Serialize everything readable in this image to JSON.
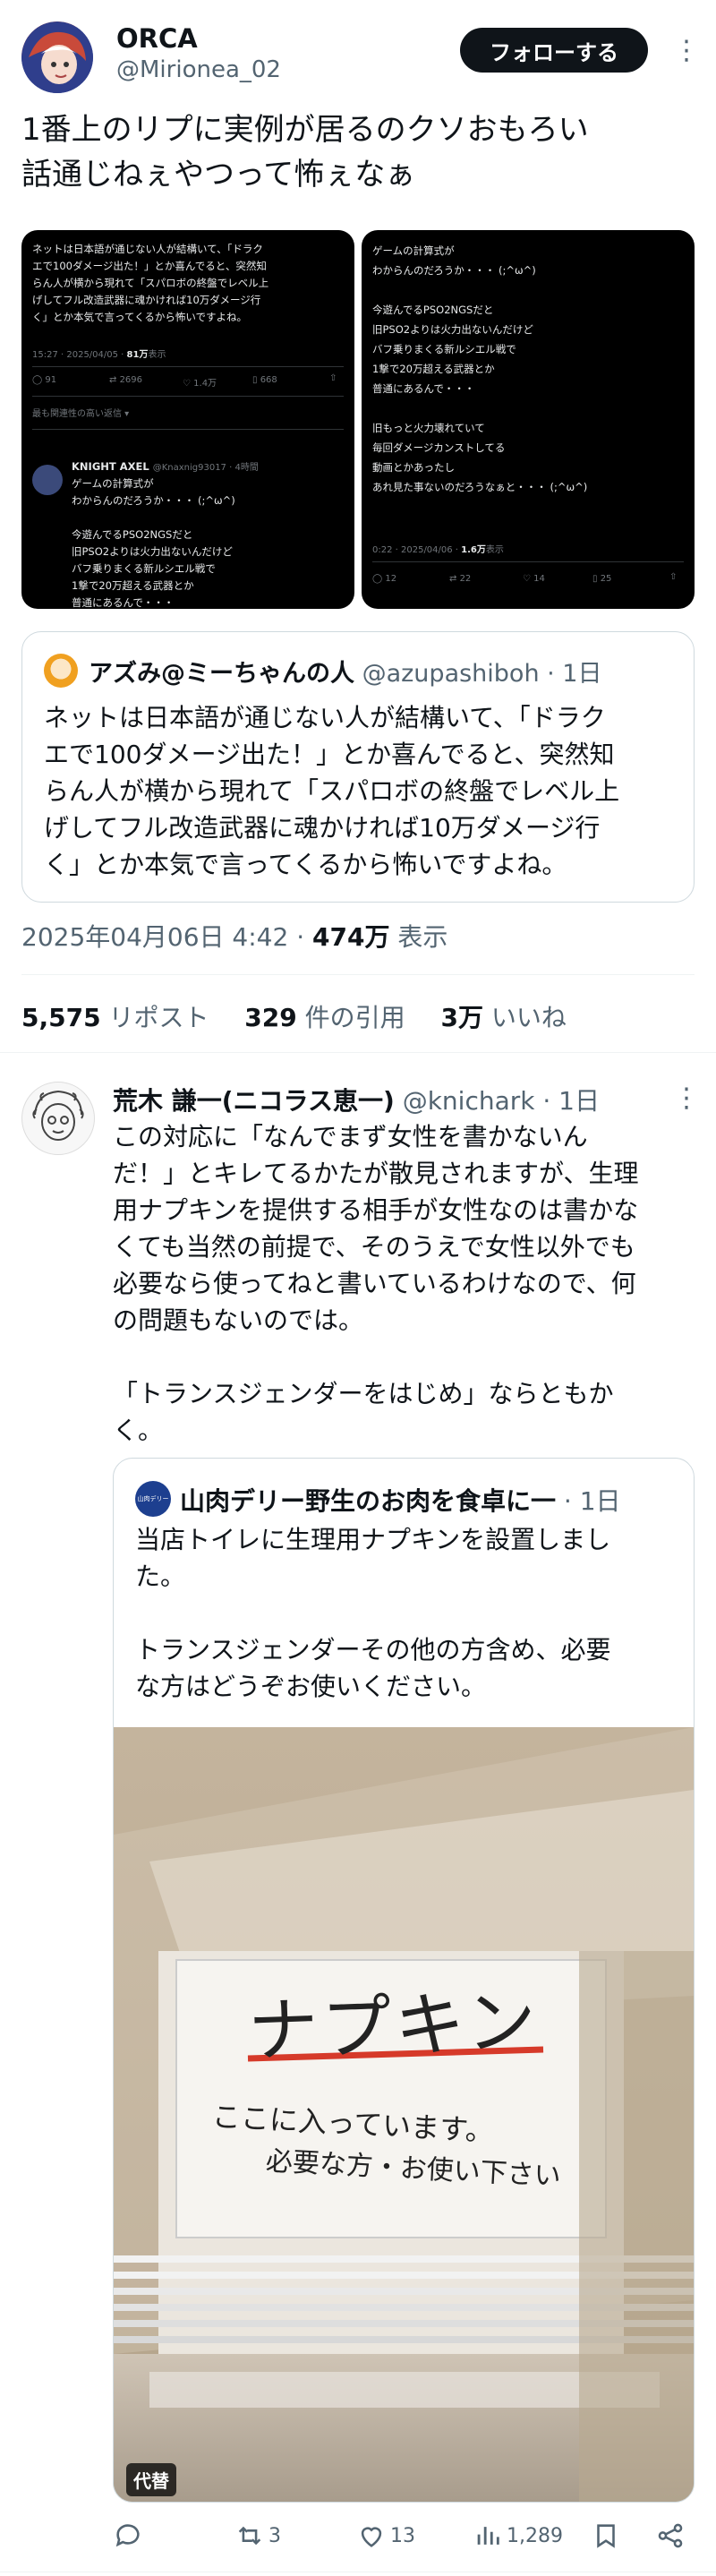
{
  "tweet": {
    "display_name": "ORCA",
    "handle": "@Mirionea_02",
    "follow_label": "フォローする",
    "more_icon": "⋮",
    "text_line1": "1番上のリプに実例が居るのクソおもろい",
    "text_line2": "話通じねぇやつって怖ぇなぁ",
    "timestamp": "2025年04月06日 4:42 · ",
    "views_count": "474万",
    "views_label": " 表示",
    "reposts_count": "5,575",
    "reposts_label": " リポスト",
    "quotes_count": "329",
    "quotes_label": " 件の引用",
    "likes_count": "3万",
    "likes_label": " いいね"
  },
  "image1": {
    "text_lines": [
      "ネットは日本語が通じない人が結構いて、「ドラク",
      "エで100ダメージ出た！」とか喜んでると、突然知",
      "らん人が横から現れて「スパロボの終盤でレベル上",
      "げしてフル改造武器に魂かければ10万ダメージ行",
      "く」とか本気で言ってくるから怖いですよね。"
    ],
    "meta_time": "15:27 · 2025/04/05 · ",
    "meta_views": "81万",
    "meta_views_label": "表示",
    "stat_replies": "91",
    "stat_reposts": "2696",
    "stat_likes": "1.4万",
    "stat_bookmarks": "668",
    "relevant_replies": "最も関連性の高い返信 ▾",
    "reply_name": "KNIGHT AXEL",
    "reply_handle": "@Knaxnig93017 · 4時間",
    "reply_lines": [
      "ゲームの計算式が",
      "わからんのだろうか・・・ (;^ω^)",
      "",
      "今遊んでるPSO2NGSだと",
      "旧PSO2よりは火力出ないんだけど",
      "バフ乗りまくる新ルシエル戦で",
      "1撃で20万超える武器とか",
      "普通にあるんで・・・"
    ]
  },
  "image2": {
    "text_lines": [
      "ゲームの計算式が",
      "わからんのだろうか・・・ (;^ω^)",
      "",
      "今遊んでるPSO2NGSだと",
      "旧PSO2よりは火力出ないんだけど",
      "バフ乗りまくる新ルシエル戦で",
      "1撃で20万超える武器とか",
      "普通にあるんで・・・",
      "",
      "旧もっと火力壊れていて",
      "毎回ダメージカンストしてる",
      "動画とかあったし",
      "あれ見た事ないのだろうなぁと・・・ (;^ω^)"
    ],
    "meta_time": "0:22 · 2025/04/06 · ",
    "meta_views": "1.6万",
    "meta_views_label": "表示",
    "stat_replies": "12",
    "stat_reposts": "22",
    "stat_likes": "14",
    "stat_bookmarks": "25"
  },
  "quote": {
    "display_name": "アズみ@ミーちゃんの人",
    "handle": "@azupashiboh",
    "time": " · 1日",
    "text_lines": [
      "ネットは日本語が通じない人が結構いて、「ドラク",
      "エで100ダメージ出た！」とか喜んでると、突然知",
      "らん人が横から現れて「スパロボの終盤でレベル上",
      "げしてフル改造武器に魂かければ10万ダメージ行",
      "く」とか本気で言ってくるから怖いですよね。"
    ]
  },
  "reply": {
    "display_name": "荒木 謙一(ニコラス恵一)",
    "handle": "@knichark",
    "time": " · 1日",
    "text_lines": [
      "この対応に「なんでまず女性を書かないん",
      "だ！」とキレてるかたが散見されますが、生理",
      "用ナプキンを提供する相手が女性なのは書かな",
      "くても当然の前提で、そのうえで女性以外でも",
      "必要なら使ってねと書いているわけなので、何",
      "の問題もないのでは。",
      "",
      "「トランスジェンダーをはじめ」ならともか",
      "く。"
    ],
    "action_reposts": "3",
    "action_likes": "13",
    "action_views": "1,289"
  },
  "nested_quote": {
    "display_name": "山肉デリー野生のお肉を食卓に一",
    "time": " · 1日",
    "avatar_text": "山肉デリー",
    "text_lines": [
      "当店トイレに生理用ナプキンを設置しまし",
      "た。",
      "",
      "トランスジェンダーその他の方含め、必要",
      "な方はどうぞお使いください。"
    ],
    "photo_sign_title": "ナプキン",
    "photo_sign_line1": "ここに入っています。",
    "photo_sign_line2": "必要な方・お使い下さい",
    "alt_badge": "代替"
  },
  "colors": {
    "text": "#0f1419",
    "muted": "#536471",
    "border": "#cfd9de",
    "accent_blue": "#1d9bf0"
  }
}
